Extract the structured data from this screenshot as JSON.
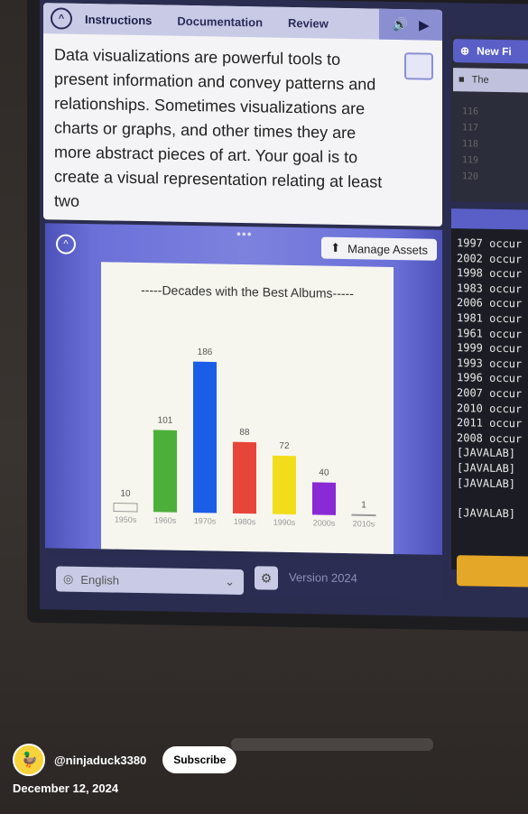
{
  "tabs": [
    "Instructions",
    "Documentation",
    "Review"
  ],
  "instructions_text": "Data visualizations are powerful tools to present information and convey patterns and relationships. Sometimes visualizations are charts or graphs, and other times they are more abstract pieces of art. Your goal is to create a visual representation relating at least two",
  "new_file_label": "New Fi",
  "file_tab_label": "The",
  "line_numbers": [
    "116",
    "117",
    "118",
    "119",
    "120"
  ],
  "manage_assets_label": "Manage Assets",
  "console_lines": [
    "1997 occur",
    "2002 occur",
    "1998 occur",
    "1983 occur",
    "2006 occur",
    "1981 occur",
    "1961 occur",
    "1999 occur",
    "1993 occur",
    "1996 occur",
    "2007 occur",
    "2010 occur",
    "2011 occur",
    "2008 occur",
    "[JAVALAB]",
    "[JAVALAB]",
    "[JAVALAB]",
    "",
    "[JAVALAB]"
  ],
  "language_label": "English",
  "version_label": "Version 2024",
  "channel_handle": "@ninjaduck3380",
  "subscribe_label": "Subscribe",
  "date": "December 12, 2024",
  "icons": {
    "collapse": "chevron-up-icon",
    "audio": "speaker-icon",
    "play": "play-icon",
    "upload": "upload-icon",
    "globe": "globe-icon",
    "settings": "gear-icon"
  },
  "colors": {
    "accent": "#5a5fc7",
    "run_button": "#e5a727"
  },
  "chart_data": {
    "type": "bar",
    "title": "-----Decades with the Best Albums-----",
    "categories": [
      "1950s",
      "1960s",
      "1970s",
      "1980s",
      "1990s",
      "2000s",
      "2010s"
    ],
    "values": [
      10,
      101,
      186,
      88,
      72,
      40,
      1
    ],
    "bar_colors": [
      "#f6f6ee",
      "#4caf3a",
      "#1a5ee8",
      "#e8453a",
      "#f2dd1c",
      "#8a2ad6",
      "#f6f6ee"
    ],
    "ylim": [
      0,
      200
    ],
    "xlabel": "",
    "ylabel": ""
  }
}
